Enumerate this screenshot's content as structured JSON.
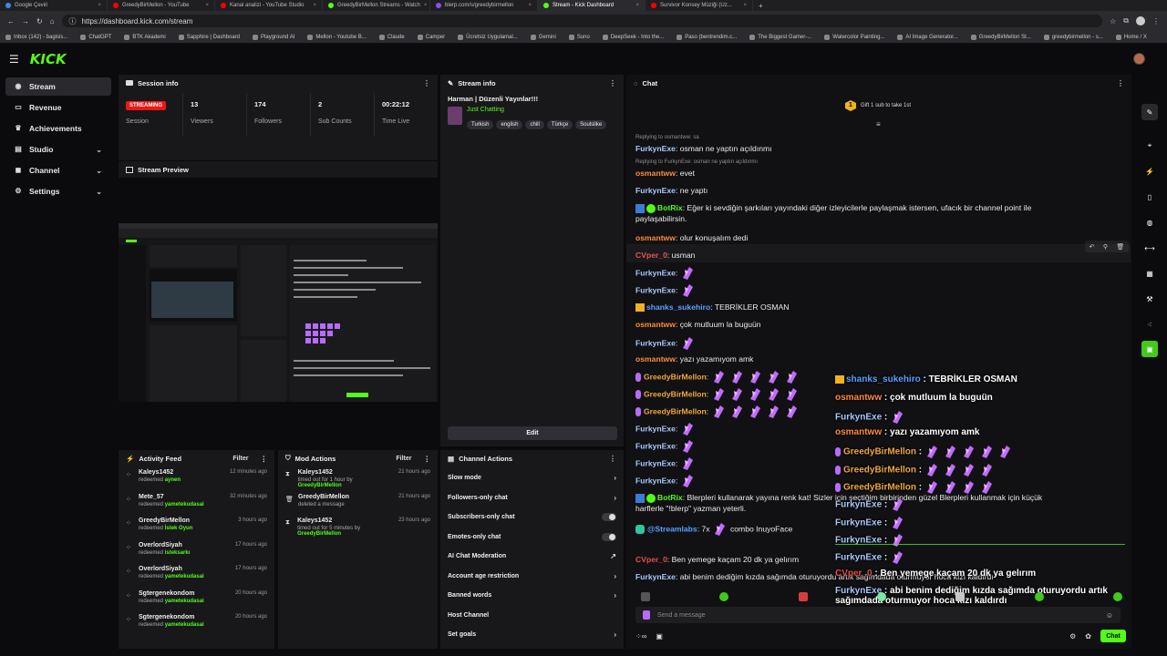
{
  "browser": {
    "tabs": [
      {
        "label": "Google Çeviri",
        "color": "#4285f4"
      },
      {
        "label": "GreedyBirMellon - YouTube",
        "color": "#ff0000"
      },
      {
        "label": "Kanal analizi - YouTube Studio",
        "color": "#ff0000"
      },
      {
        "label": "GreedyBirMellon Streams - Watch",
        "color": "#53fc18"
      },
      {
        "label": "blerp.com/s/greedybirmellon",
        "color": "#8a4dff"
      },
      {
        "label": "Stream - Kick Dashboard",
        "color": "#53fc18",
        "active": true
      },
      {
        "label": "Survivor Konsey Müziği (Uz...",
        "color": "#ff0000"
      }
    ],
    "url": "https://dashboard.kick.com/stream",
    "bookmarks": [
      "Inbox (142) - bagisis...",
      "ChatGPT",
      "BTK Akademi",
      "Sapphire | Dashboard",
      "Playground AI",
      "Mellon - Youtube B...",
      "Claude",
      "Camper",
      "Ücretsiz Uygulamal...",
      "Gemini",
      "Suno",
      "DeepSeek - Into the...",
      "Paso (bentrendim.c...",
      "The Biggest Gamer-...",
      "Watercolor Painting...",
      "AI Image Generator...",
      "GreedyBirMellon St...",
      "greedybirmellon - s...",
      "Home / X"
    ]
  },
  "header": {
    "logo": "KICK",
    "colors": {
      "brand": "#53fc18"
    }
  },
  "sidebar": {
    "items": [
      {
        "label": "Stream",
        "icon": "broadcast-icon",
        "active": true
      },
      {
        "label": "Revenue",
        "icon": "wallet-icon"
      },
      {
        "label": "Achievements",
        "icon": "trophy-icon"
      },
      {
        "label": "Studio",
        "icon": "layers-icon",
        "expand": true
      },
      {
        "label": "Channel",
        "icon": "user-icon",
        "expand": true
      },
      {
        "label": "Settings",
        "icon": "gear-icon",
        "expand": true
      }
    ]
  },
  "session": {
    "title": "Session info",
    "status": "STREAMING",
    "stats": [
      {
        "value": "",
        "label": "Session"
      },
      {
        "value": "13",
        "label": "Viewers"
      },
      {
        "value": "174",
        "label": "Followers"
      },
      {
        "value": "2",
        "label": "Sub Counts"
      },
      {
        "value": "00:22:12",
        "label": "Time Live"
      }
    ]
  },
  "preview": {
    "title": "Stream Preview"
  },
  "stream_info": {
    "title": "Stream info",
    "stream_title": "Harman | Düzenli Yayınlar!!!",
    "category": "Just Chatting",
    "tags": [
      "Turkish",
      "english",
      "chill",
      "Türkçe",
      "Soulslike"
    ],
    "edit_label": "Edit"
  },
  "activity": {
    "title": "Activity Feed",
    "filter": "Filter",
    "items": [
      {
        "name": "Kaleys1452",
        "action": "redeemed",
        "reward": "aynen",
        "time": "12 minutes ago"
      },
      {
        "name": "Mete_57",
        "action": "redeemed",
        "reward": "yametekudasai",
        "time": "32 minutes ago"
      },
      {
        "name": "GreedyBirMellon",
        "action": "redeemed",
        "reward": "İstek Oyun",
        "time": "3 hours ago"
      },
      {
        "name": "OverlordSiyah",
        "action": "redeemed",
        "reward": "isteksarkı",
        "time": "17 hours ago"
      },
      {
        "name": "OverlordSiyah",
        "action": "redeemed",
        "reward": "yametekudasai",
        "time": "17 hours ago"
      },
      {
        "name": "Sgtergenekondom",
        "action": "redeemed",
        "reward": "yametekudasai",
        "time": "20 hours ago"
      },
      {
        "name": "Sgtergenekondom",
        "action": "redeemed",
        "reward": "yametekudasai",
        "time": "20 hours ago"
      }
    ]
  },
  "mod": {
    "title": "Mod Actions",
    "filter": "Filter",
    "items": [
      {
        "name": "Kaleys1452",
        "line": "timed out for 1 hour by",
        "by": "GreedyBirMellon",
        "time": "21 hours ago"
      },
      {
        "name": "GreedyBirMellon",
        "line": "deleted a message",
        "by": "",
        "time": "21 hours ago"
      },
      {
        "name": "Kaleys1452",
        "line": "timed out for 5 minutes by",
        "by": "GreedyBirMellon",
        "time": "23 hours ago"
      }
    ]
  },
  "channel_actions": {
    "title": "Channel Actions",
    "rows": [
      "Slow mode",
      "Followers-only chat",
      "Subscribers-only chat",
      "Emotes-only chat",
      "AI Chat Moderation",
      "Account age restriction",
      "Banned words",
      "Host Channel",
      "Set goals"
    ]
  },
  "chat": {
    "title": "Chat",
    "gift_banner": "Gift 1 sub to take 1st",
    "gift_count": "1",
    "reply1": "Replying to osmantww: sa",
    "reply2": "Replying to FurkynExe: osman ne yaptın açıldınmı",
    "messages": [
      {
        "user": "FurkynExe",
        "text": "osman ne yaptın açıldınmı",
        "color": "#a8c8ff"
      },
      {
        "user": "osmantww",
        "text": "evet",
        "color": "#ff8a3d"
      },
      {
        "user": "FurkynExe",
        "text": "ne yaptı",
        "color": "#a8c8ff"
      },
      {
        "user": "BotRix",
        "text": "Eğer ki sevdiğin şarkıları yayındaki diğer izleyicilerle paylaşmak istersen, ufacık bir channel point ile",
        "text2": "paylaşabilirsin.",
        "color": "#53fc18"
      },
      {
        "user": "osmantww",
        "text": "olur konuşalım dedi",
        "color": "#ff8a3d"
      },
      {
        "user": "CVper_0",
        "text": "usman",
        "color": "#e2504d"
      },
      {
        "user": "FurkynExe",
        "text": "",
        "emotes": 1,
        "color": "#a8c8ff"
      },
      {
        "user": "FurkynExe",
        "text": "",
        "emotes": 1,
        "color": "#a8c8ff"
      },
      {
        "user": "shanks_sukehiro",
        "text": "TEBRİKLER OSMAN",
        "color": "#5aa0ff"
      },
      {
        "user": "osmantww",
        "text": "çok mutluum la buguün",
        "color": "#ff8a3d"
      },
      {
        "user": "FurkynExe",
        "text": "",
        "emotes": 1,
        "color": "#a8c8ff"
      },
      {
        "user": "osmantww",
        "text": "yazı yazamıyom amk",
        "color": "#ff8a3d"
      },
      {
        "user": "GreedyBirMellon",
        "text": "",
        "emotes": 5,
        "color": "#f0a73b"
      },
      {
        "user": "GreedyBirMellon",
        "text": "",
        "emotes": 5,
        "color": "#f0a73b"
      },
      {
        "user": "GreedyBirMellon",
        "text": "",
        "emotes": 5,
        "color": "#f0a73b"
      },
      {
        "user": "FurkynExe",
        "text": "",
        "emotes": 1,
        "color": "#a8c8ff"
      },
      {
        "user": "FurkynExe",
        "text": "",
        "emotes": 1,
        "color": "#a8c8ff"
      },
      {
        "user": "FurkynExe",
        "text": "",
        "emotes": 1,
        "color": "#a8c8ff"
      },
      {
        "user": "FurkynExe",
        "text": "",
        "emotes": 1,
        "color": "#a8c8ff"
      },
      {
        "user": "BotRix",
        "text": "Blerpleri kullanarak yayına renk kat! Sizler için seçtiğim birbirinden güzel Blerpleri kullanmak için küçük",
        "text2": "harflerle \"!blerp\" yazman yeterli.",
        "color": "#53fc18"
      },
      {
        "user": "@Streamlabs",
        "text": "7x",
        "suffix": "combo InuyoFace",
        "color": "#5aa0ff"
      },
      {
        "user": "CVper_0",
        "text": "Ben yemege kaçam 20 dk ya gelırım",
        "color": "#e2504d"
      },
      {
        "user": "FurkynExe",
        "text": "abi benim dediğim kızda sağımda oturuyordu artık sağımdada oturmuyor hoca kızı kaldırdı",
        "color": "#a8c8ff"
      }
    ],
    "overlay": [
      {
        "user": "shanks_sukehiro",
        "text": "TEBRİKLER OSMAN",
        "color": "#5aa0ff"
      },
      {
        "user": "osmantww",
        "text": "çok mutluum la buguün",
        "color": "#ff8a3d"
      },
      {
        "user": "FurkynExe",
        "text": "",
        "emotes": 1,
        "color": "#a8c8ff"
      },
      {
        "user": "osmantww",
        "text": "yazı yazamıyom amk",
        "color": "#ff8a3d"
      },
      {
        "user": "GreedyBirMellon",
        "text": "",
        "emotes": 5,
        "color": "#f0a73b"
      },
      {
        "user": "GreedyBirMellon",
        "text": "",
        "emotes": 4,
        "color": "#f0a73b"
      },
      {
        "user": "GreedyBirMellon",
        "text": "",
        "emotes": 4,
        "color": "#f0a73b"
      },
      {
        "user": "FurkynExe",
        "text": "",
        "emotes": 1,
        "color": "#a8c8ff"
      },
      {
        "user": "FurkynExe",
        "text": "",
        "emotes": 1,
        "color": "#a8c8ff"
      },
      {
        "user": "FurkynExe",
        "text": "",
        "emotes": 1,
        "color": "#a8c8ff"
      },
      {
        "user": "FurkynExe",
        "text": "",
        "emotes": 1,
        "color": "#a8c8ff"
      },
      {
        "user": "CVper_0",
        "text": "Ben yemege kaçam 20 dk ya gelırım",
        "color": "#e2504d"
      },
      {
        "user": "FurkynExe",
        "text": "abi benim dediğim kızda sağımda oturuyordu artık",
        "text2": "sağımdada oturmuyor hoca kızı kaldırdı",
        "color": "#a8c8ff"
      }
    ],
    "input_placeholder": "Send a message",
    "send_label": "Chat"
  }
}
